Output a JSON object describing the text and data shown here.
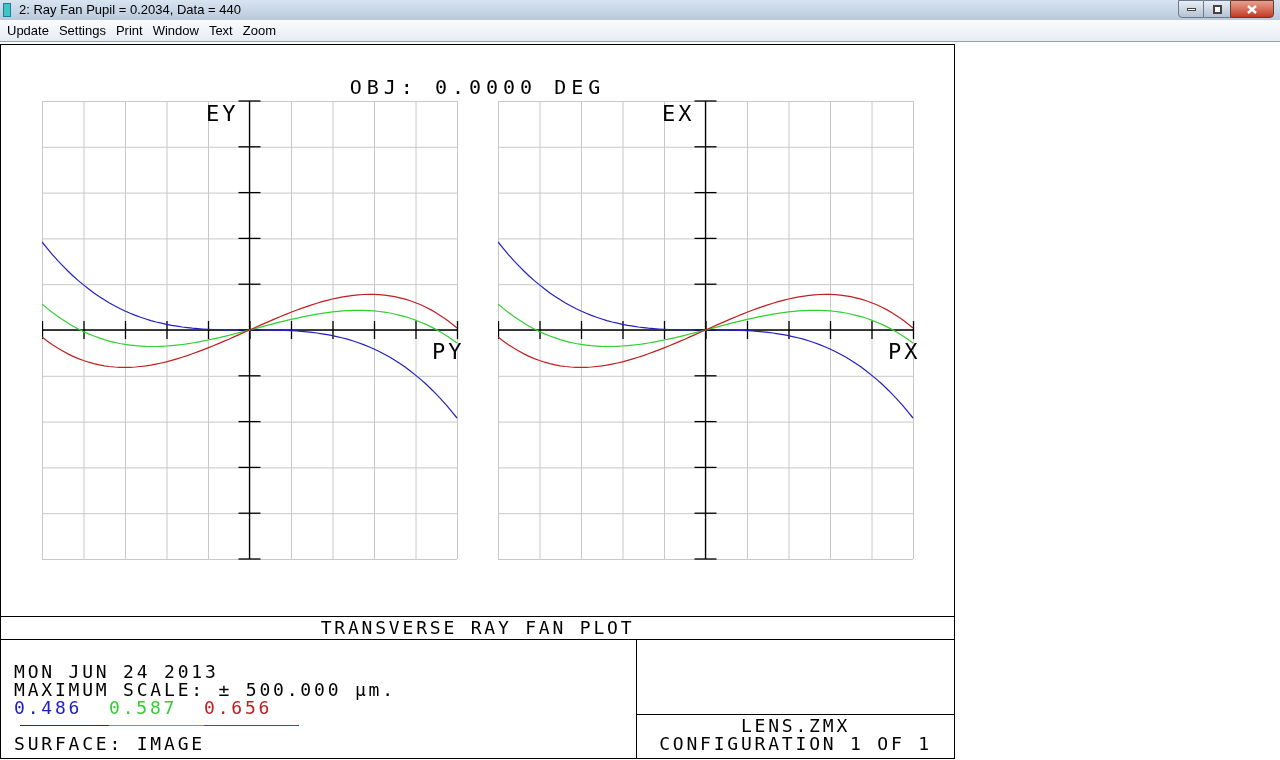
{
  "window": {
    "title": "2: Ray Fan Pupil = 0.2034, Data = 440"
  },
  "menu": [
    "Update",
    "Settings",
    "Print",
    "Window",
    "Text",
    "Zoom"
  ],
  "plot": {
    "title": "OBJ: 0.0000 DEG",
    "fans": [
      {
        "y_label": "EY",
        "x_label": "PY"
      },
      {
        "y_label": "EX",
        "x_label": "PX"
      }
    ]
  },
  "footer": {
    "title": "TRANSVERSE RAY FAN PLOT",
    "date": "MON JUN 24 2013",
    "scale": "MAXIMUM SCALE: ± 500.000 µm.",
    "wavelengths": [
      {
        "label": "0.486",
        "color": "#2020c0"
      },
      {
        "label": "0.587",
        "color": "#30d030"
      },
      {
        "label": "0.656",
        "color": "#c02020"
      }
    ],
    "surface": "SURFACE: IMAGE",
    "file": "LENS.ZMX",
    "configuration": "CONFIGURATION 1 OF 1"
  }
}
